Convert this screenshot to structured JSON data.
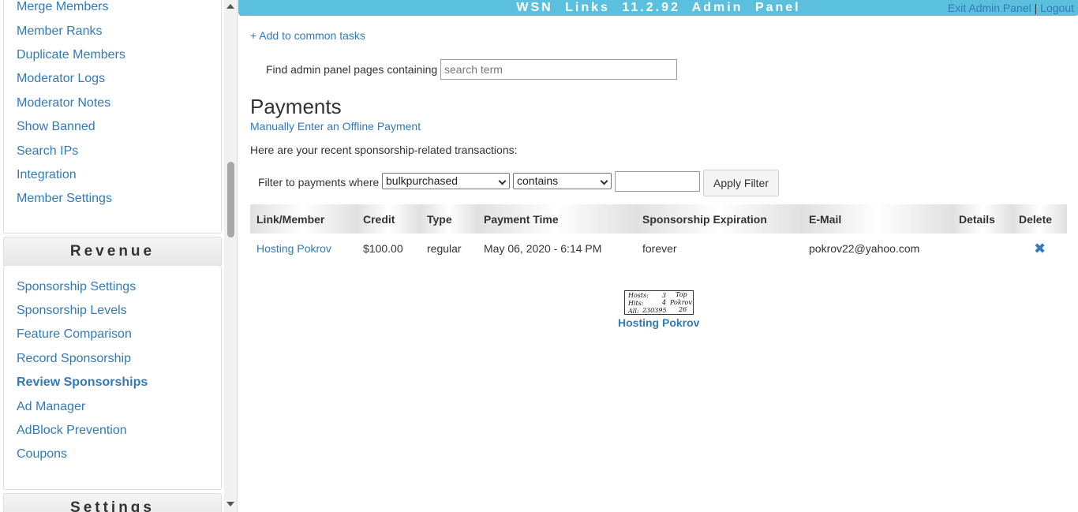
{
  "sidebar": {
    "top_items": [
      "Merge Members",
      "Member Ranks",
      "Duplicate Members",
      "Moderator Logs",
      "Moderator Notes",
      "Show Banned",
      "Search IPs",
      "Integration",
      "Member Settings"
    ],
    "revenue_header": "Revenue",
    "revenue_items": [
      "Sponsorship Settings",
      "Sponsorship Levels",
      "Feature Comparison",
      "Record Sponsorship",
      "Review Sponsorships",
      "Ad Manager",
      "AdBlock Prevention",
      "Coupons"
    ],
    "settings_header": "Settings"
  },
  "topbar": {
    "title": "WSN Links 11.2.92 Admin Panel",
    "exit_label": "Exit Admin Panel",
    "separator": "|",
    "logout_label": "Logout"
  },
  "main": {
    "add_common_tasks": "+ Add to common tasks",
    "find_label": "Find admin panel pages containing",
    "find_placeholder": "search term",
    "title": "Payments",
    "offline_link": "Manually Enter an Offline Payment",
    "intro": "Here are your recent sponsorship-related transactions:",
    "filter": {
      "label": "Filter to payments where",
      "field_value": "bulkpurchased",
      "operator_value": "contains",
      "apply_label": "Apply Filter"
    },
    "table": {
      "columns": [
        "Link/Member",
        "Credit",
        "Type",
        "Payment Time",
        "Sponsorship Expiration",
        "E-Mail",
        "Details",
        "Delete"
      ],
      "rows": [
        {
          "link": "Hosting Pokrov",
          "credit": "$100.00",
          "type": "regular",
          "time": "May 06, 2020 - 6:14 PM",
          "expiration": "forever",
          "email": "pokrov22@yahoo.com",
          "details": ""
        }
      ]
    },
    "counter": {
      "hosts_label": "Hosts:",
      "hosts_value": "3",
      "hits_label": "Hits:",
      "hits_value": "4",
      "all_label": "All:",
      "all_value": "230395",
      "top_label": "Top",
      "name_label": "Pokrov",
      "rank_value": "26",
      "link_text": "Hosting Pokrov"
    }
  },
  "icons": {
    "delete": "close-icon"
  },
  "colors": {
    "topbar": "#5bc0de",
    "link": "#337ab7"
  }
}
